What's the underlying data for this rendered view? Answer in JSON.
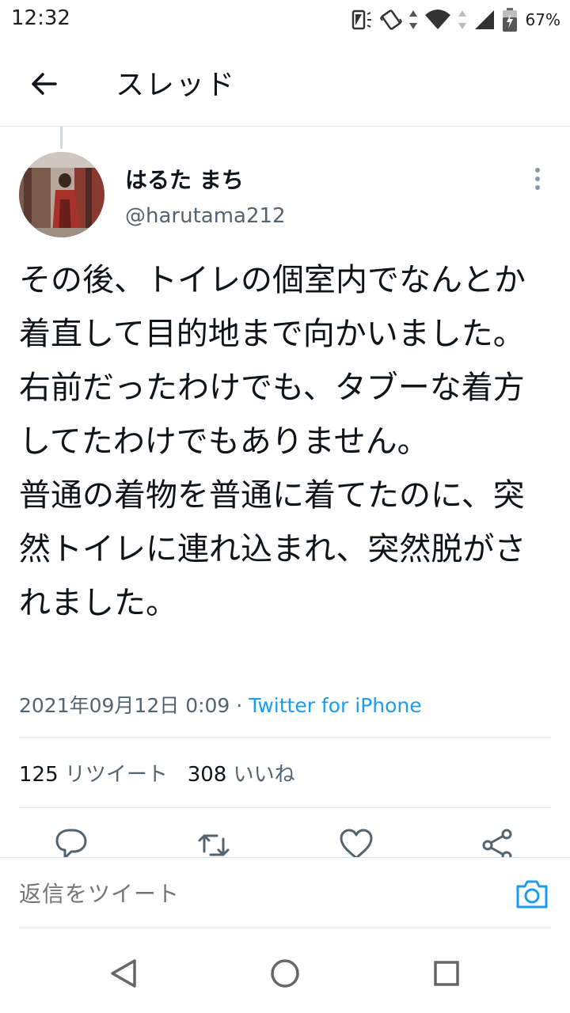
{
  "status_bar": {
    "time": "12:32",
    "battery": "67%"
  },
  "header": {
    "title": "スレッド"
  },
  "author": {
    "name": "はるた まち",
    "handle": "@harutama212"
  },
  "tweet": {
    "text": "その後、トイレの個室内でなんとか着直して目的地まで向かいました。\n右前だったわけでも、タブーな着方してたわけでもありません。\n普通の着物を普通に着てたのに、突然トイレに連れ込まれ、突然脱がされました。",
    "date": "2021年09月12日 0:09",
    "separator": " · ",
    "source": "Twitter for iPhone"
  },
  "stats": {
    "retweets_count": "125",
    "retweets_label": "リツイート",
    "likes_count": "308",
    "likes_label": "いいね"
  },
  "reply": {
    "placeholder": "返信をツイート"
  },
  "icons": {
    "back": "arrow-left-icon",
    "more": "more-vertical-icon",
    "reply": "reply-icon",
    "retweet": "retweet-icon",
    "like": "heart-icon",
    "share": "share-icon",
    "camera": "camera-icon"
  },
  "colors": {
    "accent": "#1d9bf0",
    "text": "#0f1419",
    "secondary": "#536471"
  }
}
